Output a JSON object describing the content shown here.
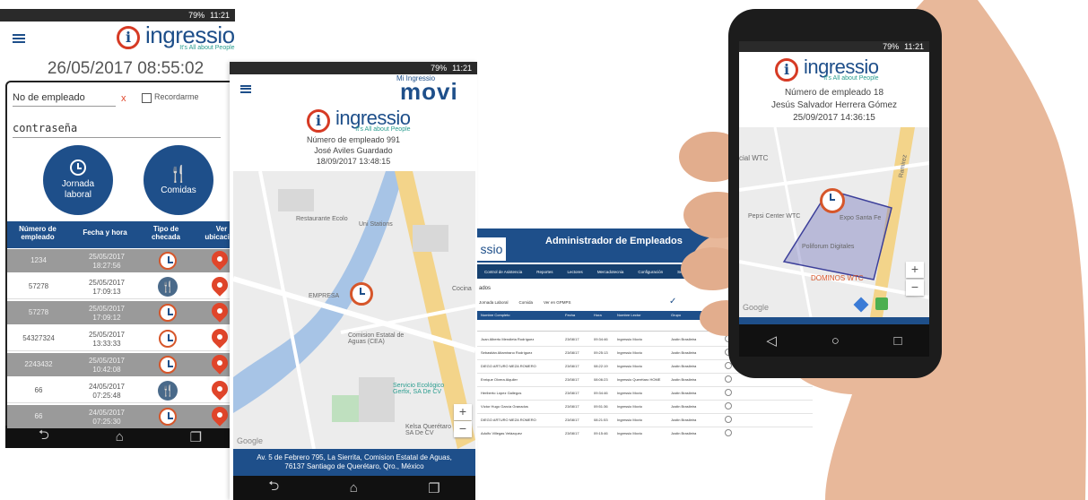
{
  "status": {
    "time": "11:21",
    "battery": "79%"
  },
  "brand": {
    "name": "ingressio",
    "tagline": "It's All about People",
    "letter": "i"
  },
  "phone1": {
    "datetime": "26/05/2017 08:55:02",
    "employee_placeholder": "No de empleado",
    "clear_mark": "x",
    "remember_label": "Recordarme",
    "password_placeholder": "contraseña",
    "btn_jornada": "Jornada laboral",
    "btn_comidas": "Comidas",
    "headers": [
      "Número de empleado",
      "Fecha y hora",
      "Tipo de checada",
      "Ver ubicación"
    ],
    "rows": [
      {
        "id": "1234",
        "date": "25/05/2017",
        "time": "18:27:56",
        "type": "clock"
      },
      {
        "id": "57278",
        "date": "25/05/2017",
        "time": "17:09:13",
        "type": "fork"
      },
      {
        "id": "57278",
        "date": "25/05/2017",
        "time": "17:09:12",
        "type": "clock"
      },
      {
        "id": "54327324",
        "date": "25/05/2017",
        "time": "13:33:33",
        "type": "clock"
      },
      {
        "id": "2243432",
        "date": "25/05/2017",
        "time": "10:42:08",
        "type": "clock"
      },
      {
        "id": "66",
        "date": "24/05/2017",
        "time": "07:25:48",
        "type": "fork"
      },
      {
        "id": "66",
        "date": "24/05/2017",
        "time": "07:25:30",
        "type": "clock"
      }
    ]
  },
  "phone2": {
    "app_small": "Mi Ingressio",
    "app_big": "movi",
    "employee": "Número de empleado 991",
    "name": "José Aviles Guardado",
    "datetime": "18/09/2017 13:48:15",
    "map_labels": [
      "Restaurante Ecolo",
      "Uni Stations",
      "EMPRESA",
      "Comision Estatal de Aguas (CEA)",
      "Servicio Ecológico Gerfix, SA De CV",
      "Kelsa Querétaro SA De CV",
      "Cocina"
    ],
    "zoom_in": "+",
    "zoom_out": "−",
    "google": "Google",
    "address": "Av. 5 de Febrero 795, La Sierrita, Comision Estatal de Aguas, 76137 Santiago de Querétaro, Qro., México"
  },
  "admin": {
    "brand_partial": "ssio",
    "title": "Administrador de Empleados",
    "menu": [
      "Control de Asistencia",
      "Reportes",
      "Lectores",
      "Mercadotecnia",
      "Configuración",
      "Seguridad"
    ],
    "section": "ados",
    "legend": [
      "Jornada Laboral",
      "Comida",
      "Ver en GPMPS"
    ],
    "headers": [
      "Nombre Completo",
      "Fecha",
      "Hora",
      "Nombre Lector",
      "Grupo"
    ],
    "rows": [
      [
        "Juan Alberto Mendieta Rodríguez",
        "23/08/17",
        "09:34:46",
        "Ingressio Movio",
        "Justin Brasileira"
      ],
      [
        "Sebastián Altamirano Rodríguez",
        "23/08/17",
        "09:25:13",
        "Ingressio Movio",
        "Justin Brasileira"
      ],
      [
        "DIEGO ARTURO MEZA ROMERO",
        "23/08/17",
        "08:22:19",
        "Ingressio Movio",
        "Justin Brasileira"
      ],
      [
        "Enrique Olvera Alquiler",
        "23/08/17",
        "08:06:23",
        "Ingressio Querétaro HOME",
        "Justin Brasileira"
      ],
      [
        "Heriberto López Gallegos",
        "23/08/17",
        "09:34:46",
        "Ingressio Movio",
        "Justin Brasileira"
      ],
      [
        "Víctor Hugo García Granados",
        "23/08/17",
        "09:51:36",
        "Ingressio Movio",
        "Justin Brasileira"
      ],
      [
        "DIEGO ARTURO MEZA ROMERO",
        "23/08/17",
        "08:21:53",
        "Ingressio Movio",
        "Justin Brasileira"
      ],
      [
        "Adolfo Villegas Velázquez",
        "23/08/17",
        "09:15:46",
        "Ingressio Movio",
        "Justin Brasileira"
      ]
    ]
  },
  "phone3": {
    "employee": "Número de empleado 18",
    "name": "Jesús Salvador Herrera Gómez",
    "datetime": "25/09/2017 14:36:15",
    "map_labels": [
      "cial WTC",
      "Pepsi Center WTC",
      "Expo Santa Fe",
      "Poliforum Digitales",
      "DOMINOS WTC",
      "Ramirez"
    ],
    "zoom_in": "+",
    "zoom_out": "−",
    "google": "Google"
  },
  "colors": {
    "brand_blue": "#1e4f8a",
    "brand_red": "#d63a24",
    "teal": "#2a9d8f",
    "skin": "#e8b89a"
  }
}
